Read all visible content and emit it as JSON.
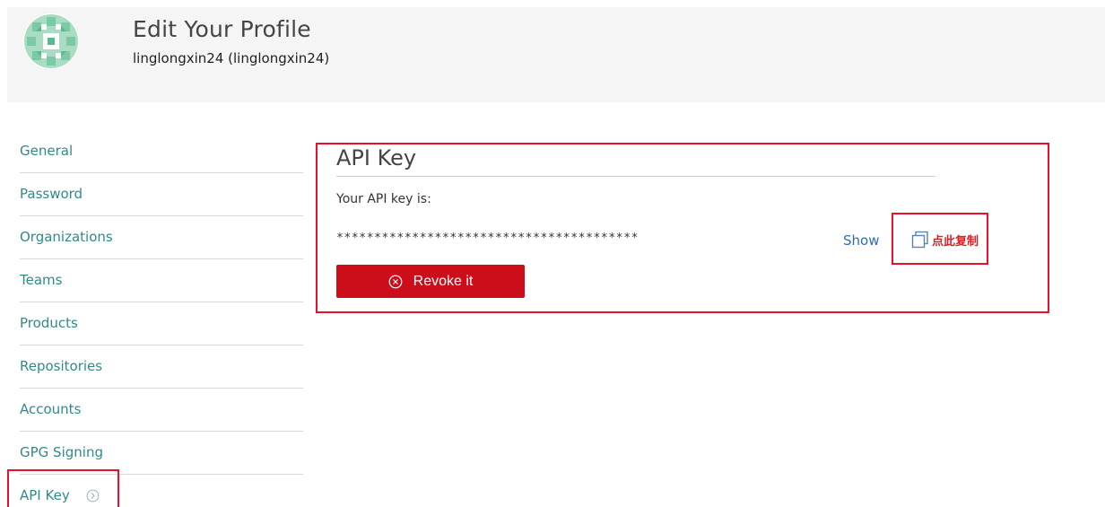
{
  "header": {
    "title": "Edit Your Profile",
    "subtitle": "linglongxin24 (linglongxin24)",
    "avatar_icon": "identicon-avatar"
  },
  "sidebar": {
    "items": [
      {
        "label": "General"
      },
      {
        "label": "Password"
      },
      {
        "label": "Organizations"
      },
      {
        "label": "Teams"
      },
      {
        "label": "Products"
      },
      {
        "label": "Repositories"
      },
      {
        "label": "Accounts"
      },
      {
        "label": "GPG Signing"
      },
      {
        "label": "API Key",
        "active": true,
        "icon": "chevron-circle-right-icon"
      }
    ]
  },
  "panel": {
    "title": "API Key",
    "api_label": "Your API key is:",
    "api_key_masked": "****************************************",
    "show_label": "Show",
    "copy_label": "点此复制",
    "revoke_label": "Revoke it"
  },
  "colors": {
    "link": "#2f8a8a",
    "accent_red": "#cc0e1b",
    "annotation_red": "#e8102a",
    "header_bg": "#f5f5f5"
  }
}
